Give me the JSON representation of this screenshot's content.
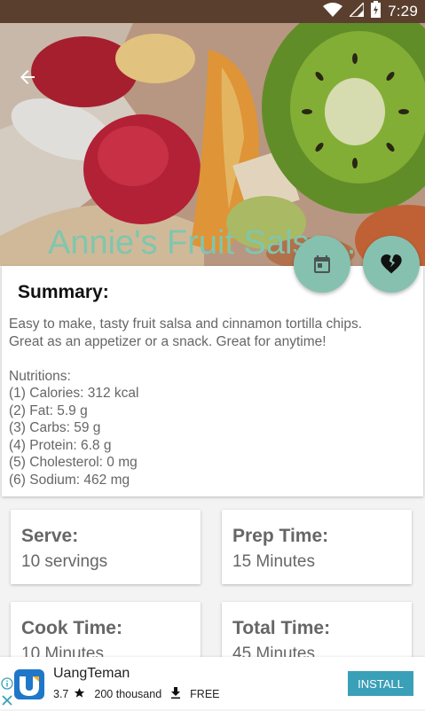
{
  "status_bar": {
    "time": "7:29",
    "icons": [
      "wifi-icon",
      "signal-icon",
      "battery-charging-icon"
    ]
  },
  "recipe": {
    "title": "Annie's Fruit Salsa...",
    "summary_heading": "Summary:",
    "summary_lines": [
      "Easy to make, tasty fruit salsa and cinnamon tortilla chips.",
      "Great as an appetizer or a snack. Great for anytime!",
      "",
      "Nutritions:",
      "(1) Calories: 312 kcal",
      "(2) Fat: 5.9 g",
      "(3) Carbs: 59 g",
      "(4) Protein: 6.8 g",
      "(5) Cholesterol: 0 mg",
      "(6) Sodium: 462 mg"
    ],
    "info": {
      "serve_label": "Serve:",
      "serve_value": "10 servings",
      "prep_label": "Prep Time:",
      "prep_value": "15 Minutes",
      "cook_label": "Cook Time:",
      "cook_value": "10 Minutes",
      "total_label": "Total Time:",
      "total_value": "45 Minutes"
    }
  },
  "actions": {
    "back_icon": "arrow-back-icon",
    "calendar_icon": "calendar-icon",
    "heart_icon": "broken-heart-icon"
  },
  "ad": {
    "app_name": "UangTeman",
    "rating": "3.7",
    "downloads": "200 thousand",
    "price": "FREE",
    "install_label": "INSTALL"
  },
  "colors": {
    "accent": "#86c1b0",
    "title": "#7fc6ae",
    "status_bar": "#5b3f2e",
    "install": "#3aa0b8"
  }
}
